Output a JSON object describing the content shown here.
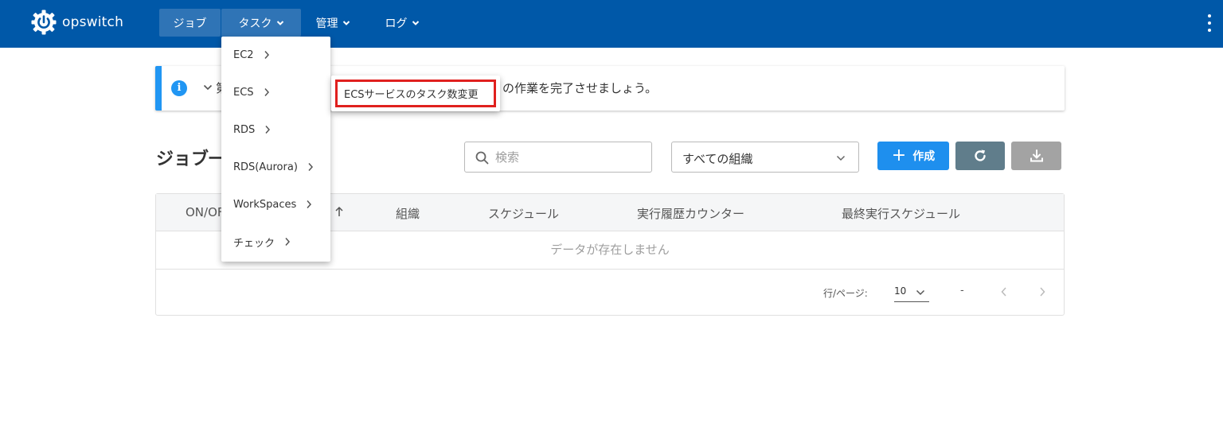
{
  "app": {
    "name": "opswitch"
  },
  "nav": {
    "items": [
      {
        "label": "ジョブ",
        "active": false,
        "has_dropdown": false
      },
      {
        "label": "タスク",
        "active": true,
        "has_dropdown": true
      },
      {
        "label": "管理",
        "active": false,
        "has_dropdown": true
      },
      {
        "label": "ログ",
        "active": false,
        "has_dropdown": true
      }
    ]
  },
  "alert": {
    "text_start": "第",
    "text_end": "の作業を完了させましょう。"
  },
  "page": {
    "title": "ジョブ一"
  },
  "search": {
    "placeholder": "検索",
    "value": ""
  },
  "org_select": {
    "value": "すべての組織"
  },
  "buttons": {
    "create_label": "作成"
  },
  "table": {
    "columns": [
      "ON/OFF",
      "組織",
      "スケジュール",
      "実行履歴カウンター",
      "最終実行スケジュール"
    ],
    "empty_text": "データが存在しません",
    "pager": {
      "rows_label": "行/ページ:",
      "rows_value": "10",
      "range": "-"
    }
  },
  "task_menu": {
    "items": [
      {
        "label": "EC2"
      },
      {
        "label": "ECS"
      },
      {
        "label": "RDS"
      },
      {
        "label": "RDS(Aurora)"
      },
      {
        "label": "WorkSpaces"
      },
      {
        "label": "チェック"
      }
    ],
    "submenu": {
      "label": "ECSサービスのタスク数変更",
      "highlight_color": "#e0201e"
    }
  },
  "colors": {
    "header": "#0058a8",
    "accent": "#2196f3",
    "create": "#1e8fee",
    "refresh": "#607d8b",
    "download": "#a3a3a3"
  }
}
